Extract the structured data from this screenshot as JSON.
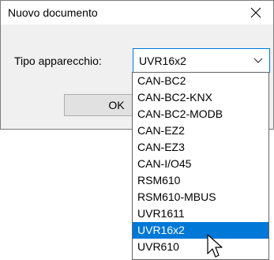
{
  "window": {
    "title": "Nuovo documento"
  },
  "form": {
    "device_label": "Tipo apparecchio:",
    "device_value": "UVR16x2",
    "ok_label": "OK"
  },
  "dropdown": {
    "selected_index": 9,
    "items": [
      "CAN-BC2",
      "CAN-BC2-KNX",
      "CAN-BC2-MODB",
      "CAN-EZ2",
      "CAN-EZ3",
      "CAN-I/O45",
      "RSM610",
      "RSM610-MBUS",
      "UVR1611",
      "UVR16x2",
      "UVR610"
    ]
  },
  "colors": {
    "accent": "#0078d7",
    "button_face": "#e1e1e1",
    "dialog_bg": "#f0f0f0"
  },
  "icons": {
    "close": "close-icon",
    "combo_arrow": "chevron-down-icon",
    "pointer": "mouse-cursor-icon"
  }
}
